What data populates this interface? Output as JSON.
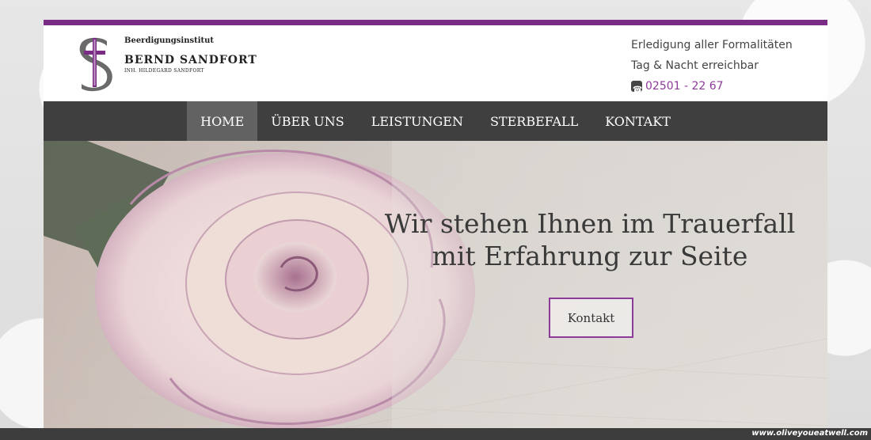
{
  "brand": {
    "subtitle": "Beerdigungsinstitut",
    "name": "BERND SANDFORT",
    "owner": "INH. HILDEGARD SANDFORT"
  },
  "header_info": {
    "line1": "Erledigung aller Formalitäten",
    "line2": "Tag & Nacht erreichbar",
    "phone": "02501 - 22 67"
  },
  "nav": {
    "items": [
      {
        "label": "HOME",
        "active": true
      },
      {
        "label": "ÜBER UNS"
      },
      {
        "label": "LEISTUNGEN"
      },
      {
        "label": "STERBEFALL"
      },
      {
        "label": "KONTAKT"
      }
    ]
  },
  "hero": {
    "title_line1": "Wir stehen Ihnen im Trauerfall",
    "title_line2": "mit Erfahrung zur Seite",
    "button": "Kontakt"
  },
  "watermark": "www.oliveyoueatwell.com",
  "colors": {
    "accent": "#7b2d86",
    "phone": "#8e3a9a",
    "nav_bg": "#3f3f3f",
    "nav_active": "#626262"
  }
}
